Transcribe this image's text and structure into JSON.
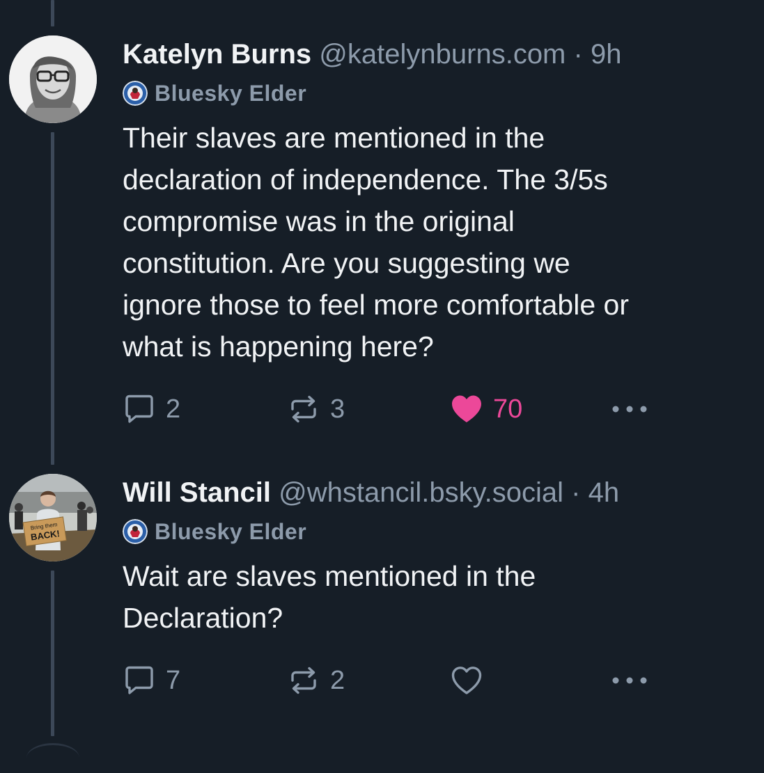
{
  "posts": [
    {
      "author_name": "Katelyn Burns",
      "handle": "@katelynburns.com",
      "separator": "·",
      "time": "9h",
      "badge_label": "Bluesky Elder",
      "avatar_icon": "person-with-glasses-avatar",
      "text": "Their slaves are mentioned in the\ndeclaration of independence. The 3/5s\ncompromise was in the original\nconstitution. Are you suggesting we\nignore those to feel more comfortable or\nwhat is happening here?",
      "reply_count": "2",
      "repost_count": "3",
      "like_count": "70",
      "liked": true
    },
    {
      "author_name": "Will Stancil",
      "handle": "@whstancil.bsky.social",
      "separator": "·",
      "time": "4h",
      "badge_label": "Bluesky Elder",
      "avatar_icon": "person-holding-sign-avatar",
      "avatar_sign_text": "Bring them BACK!",
      "text": "Wait are slaves mentioned in the\nDeclaration?",
      "reply_count": "7",
      "repost_count": "2",
      "like_count": "",
      "liked": false
    }
  ],
  "colors": {
    "background": "#161e27",
    "text_primary": "#f1f3f5",
    "text_secondary": "#8d9bab",
    "like_pink": "#ec4899",
    "thread_line": "#3c4858"
  },
  "icons": {
    "reply": "reply-bubble-icon",
    "repost": "repost-arrows-icon",
    "like": "heart-icon",
    "more": "more-dots-icon"
  }
}
